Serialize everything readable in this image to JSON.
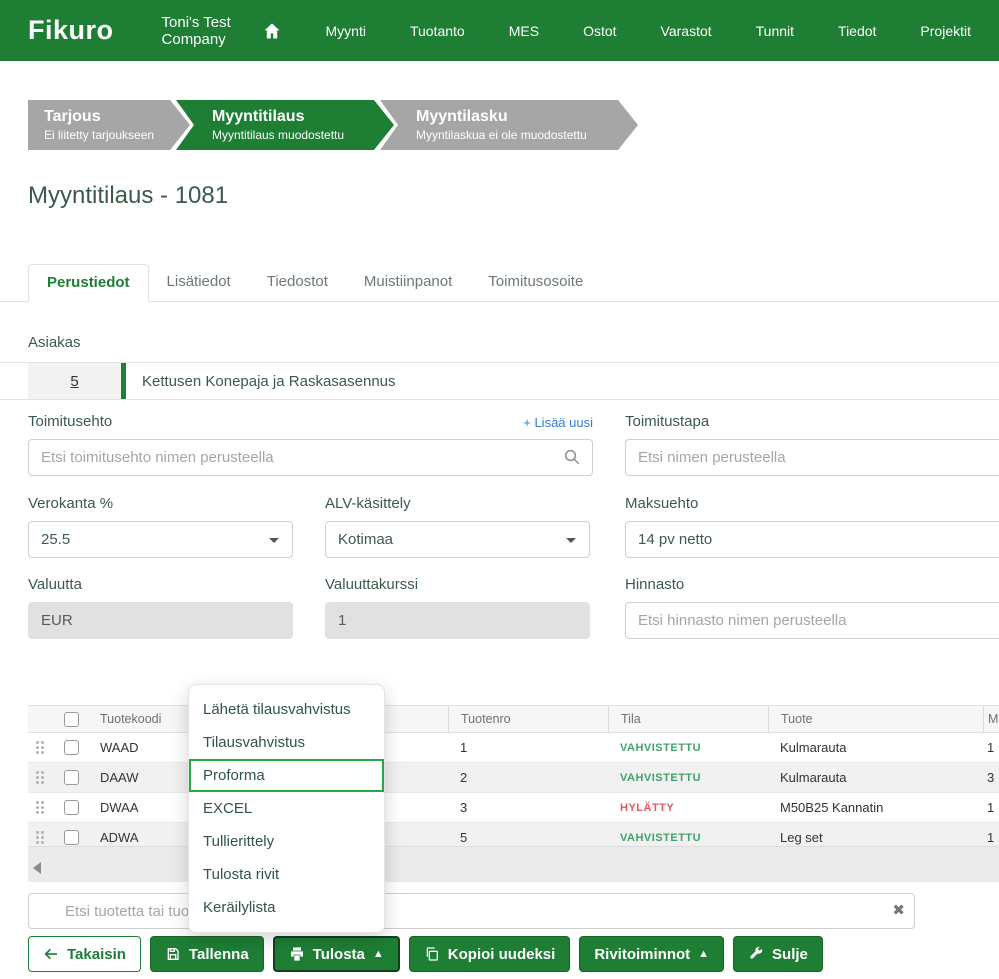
{
  "header": {
    "brand": "Fikuro",
    "company": "Toni's Test Company",
    "nav": [
      "Myynti",
      "Tuotanto",
      "MES",
      "Ostot",
      "Varastot",
      "Tunnit",
      "Tiedot",
      "Projektit"
    ]
  },
  "steps": [
    {
      "title": "Tarjous",
      "subtitle": "Ei liitetty tarjoukseen",
      "state": "inactive"
    },
    {
      "title": "Myyntitilaus",
      "subtitle": "Myyntitilaus muodostettu",
      "state": "active"
    },
    {
      "title": "Myyntilasku",
      "subtitle": "Myyntilaskua ei ole muodostettu",
      "state": "inactive"
    }
  ],
  "page_title": "Myyntitilaus - 1081",
  "tabs": [
    {
      "label": "Perustiedot",
      "state": "active"
    },
    {
      "label": "Lisätiedot",
      "state": "normal"
    },
    {
      "label": "Tiedostot",
      "state": "normal"
    },
    {
      "label": "Muistiinpanot",
      "state": "normal"
    },
    {
      "label": "Toimitusosoite",
      "state": "normal"
    }
  ],
  "customer": {
    "label": "Asiakas",
    "number": "5",
    "name": "Kettusen Konepaja ja Raskasasennus"
  },
  "form": {
    "toimitusehto": {
      "label": "Toimitusehto",
      "placeholder": "Etsi toimitusehto nimen perusteella",
      "add_link": "+ Lisää uusi"
    },
    "toimitustapa": {
      "label": "Toimitustapa",
      "placeholder": "Etsi nimen perusteella"
    },
    "verokanta": {
      "label": "Verokanta %",
      "value": "25.5"
    },
    "alv": {
      "label": "ALV-käsittely",
      "value": "Kotimaa"
    },
    "maksuehto": {
      "label": "Maksuehto",
      "value": "14 pv netto"
    },
    "valuutta": {
      "label": "Valuutta",
      "value": "EUR"
    },
    "valuuttakurssi": {
      "label": "Valuuttakurssi",
      "value": "1"
    },
    "hinnasto": {
      "label": "Hinnasto",
      "placeholder": "Etsi hinnasto nimen perusteella"
    }
  },
  "table": {
    "headers": [
      "Tuotekoodi",
      "Tuotenro",
      "Tila",
      "Tuote",
      "Määrä"
    ],
    "rows": [
      {
        "code": "WAAD",
        "nro": "1",
        "tila": "VAHVISTETTU",
        "status": "ok",
        "tuote": "Kulmarauta",
        "maara": "1"
      },
      {
        "code": "DAAW",
        "nro": "2",
        "tila": "VAHVISTETTU",
        "status": "ok",
        "tuote": "Kulmarauta",
        "maara": "3"
      },
      {
        "code": "DWAA",
        "nro": "3",
        "tila": "HYLÄTTY",
        "status": "rejected",
        "tuote": "M50B25 Kannatin",
        "maara": "1"
      },
      {
        "code": "ADWA",
        "nro": "5",
        "tila": "VAHVISTETTU",
        "status": "ok",
        "tuote": "Leg set",
        "maara": "1"
      }
    ]
  },
  "menu": {
    "items": [
      {
        "label": "Lähetä tilausvahvistus",
        "state": "normal"
      },
      {
        "label": "Tilausvahvistus",
        "state": "normal"
      },
      {
        "label": "Proforma",
        "state": "highlighted"
      },
      {
        "label": "EXCEL",
        "state": "normal"
      },
      {
        "label": "Tullierittely",
        "state": "normal"
      },
      {
        "label": "Tulosta rivit",
        "state": "normal"
      },
      {
        "label": "Keräilylista",
        "state": "normal"
      }
    ]
  },
  "search": {
    "placeholder": "Etsi tuotetta tai tuot"
  },
  "footer": {
    "buttons": [
      {
        "label": "Takaisin"
      },
      {
        "label": "Tallenna"
      },
      {
        "label": "Tulosta"
      },
      {
        "label": "Kopioi uudeksi"
      },
      {
        "label": "Rivitoiminnot"
      },
      {
        "label": "Sulje"
      }
    ]
  },
  "icons": {
    "clear": "✖",
    "caret_up": "▲"
  },
  "colors": {
    "primary_green": "#1e7e34",
    "status_ok": "#43a06b",
    "status_rejected": "#e05c5c",
    "highlight": "#28a745"
  }
}
